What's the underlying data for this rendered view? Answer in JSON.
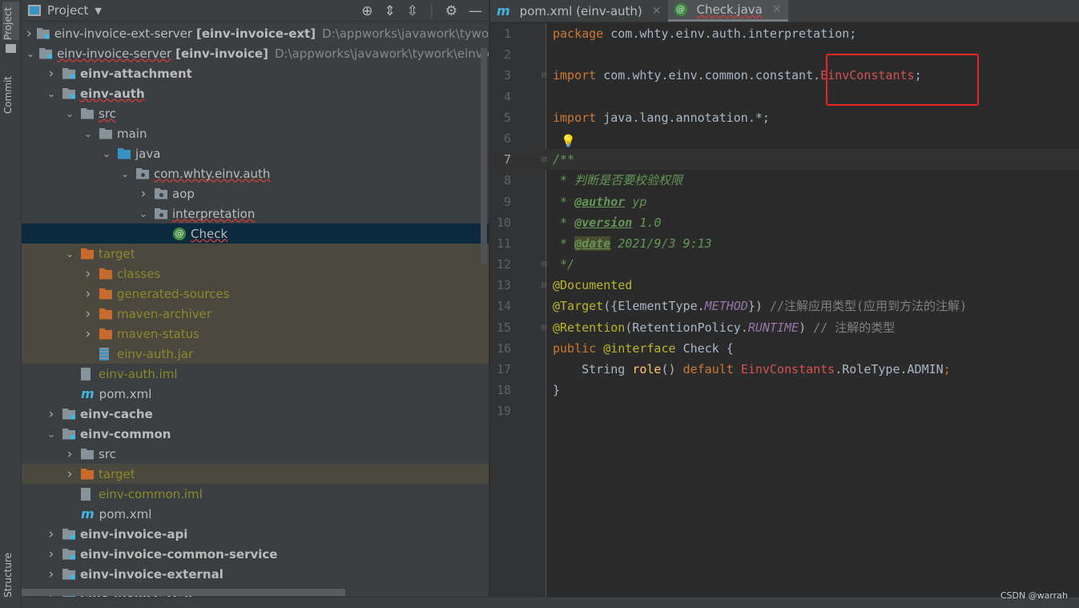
{
  "left_strip": {
    "project_tab": "Project",
    "commit_tab": "Commit",
    "structure_tab": "Structure"
  },
  "panel": {
    "title": "Project"
  },
  "tree": [
    {
      "label": "einv-invoice-ext-server",
      "suffix": "[einv-invoice-ext]",
      "path": "D:\\appworks\\javawork\\tywork\\einv\\einv-invoice-ext",
      "level": 0,
      "chev": "collapsed",
      "icon": "module-folder"
    },
    {
      "label": "einv-invoice-server",
      "suffix": "[einv-invoice]",
      "path": "D:\\appworks\\javawork\\tywork\\einv\\einv-invoice",
      "level": 0,
      "chev": "expanded",
      "icon": "module-folder",
      "squig": true
    },
    {
      "label": "einv-attachment",
      "level": 1,
      "chev": "collapsed",
      "icon": "module-folder",
      "bold": true
    },
    {
      "label": "einv-auth",
      "level": 1,
      "chev": "expanded",
      "icon": "module-folder",
      "bold": true,
      "squig": true
    },
    {
      "label": "src",
      "level": 2,
      "chev": "expanded",
      "icon": "folder",
      "squig": true
    },
    {
      "label": "main",
      "level": 3,
      "chev": "expanded",
      "icon": "folder"
    },
    {
      "label": "java",
      "level": 4,
      "chev": "expanded",
      "icon": "source-folder"
    },
    {
      "label": "com.whty.einv.auth",
      "level": 5,
      "chev": "expanded",
      "icon": "package",
      "squig": true
    },
    {
      "label": "aop",
      "level": 6,
      "chev": "collapsed",
      "icon": "package"
    },
    {
      "label": "interpretation",
      "level": 6,
      "chev": "expanded",
      "icon": "package",
      "squig": true
    },
    {
      "label": "Check",
      "level": 7,
      "icon": "annotation",
      "selected": true,
      "squig": true
    },
    {
      "label": "target",
      "level": 2,
      "chev": "expanded",
      "icon": "excluded-folder",
      "excluded": true
    },
    {
      "label": "classes",
      "level": 3,
      "chev": "collapsed",
      "icon": "excluded-folder",
      "excluded": true
    },
    {
      "label": "generated-sources",
      "level": 3,
      "chev": "collapsed",
      "icon": "excluded-folder",
      "excluded": true
    },
    {
      "label": "maven-archiver",
      "level": 3,
      "chev": "collapsed",
      "icon": "excluded-folder",
      "excluded": true
    },
    {
      "label": "maven-status",
      "level": 3,
      "chev": "collapsed",
      "icon": "excluded-folder",
      "excluded": true
    },
    {
      "label": "einv-auth.jar",
      "level": 3,
      "icon": "jar",
      "excluded": true
    },
    {
      "label": "einv-auth.iml",
      "level": 2,
      "icon": "iml",
      "olive": true
    },
    {
      "label": "pom.xml",
      "level": 2,
      "icon": "maven"
    },
    {
      "label": "einv-cache",
      "level": 1,
      "chev": "collapsed",
      "icon": "module-folder",
      "bold": true
    },
    {
      "label": "einv-common",
      "level": 1,
      "chev": "expanded",
      "icon": "module-folder",
      "bold": true
    },
    {
      "label": "src",
      "level": 2,
      "chev": "collapsed",
      "icon": "folder"
    },
    {
      "label": "target",
      "level": 2,
      "chev": "collapsed",
      "icon": "excluded-folder",
      "excluded": true
    },
    {
      "label": "einv-common.iml",
      "level": 2,
      "icon": "iml",
      "olive": true
    },
    {
      "label": "pom.xml",
      "level": 2,
      "icon": "maven"
    },
    {
      "label": "einv-invoice-api",
      "level": 1,
      "chev": "collapsed",
      "icon": "module-folder",
      "bold": true
    },
    {
      "label": "einv-invoice-common-service",
      "level": 1,
      "chev": "collapsed",
      "icon": "module-folder",
      "bold": true
    },
    {
      "label": "einv-invoice-external",
      "level": 1,
      "chev": "collapsed",
      "icon": "module-folder",
      "bold": true
    },
    {
      "label": "einv-invoice-rest",
      "level": 1,
      "chev": "collapsed",
      "icon": "module-folder",
      "bold": true
    }
  ],
  "tabs": [
    {
      "label": "pom.xml (einv-auth)",
      "icon": "maven-icon",
      "active": false
    },
    {
      "label": "Check.java",
      "icon": "annotation-icon",
      "active": true
    }
  ],
  "code": [
    [
      [
        "kw",
        "package "
      ],
      [
        "",
        "com.whty.einv.auth.interpretation;"
      ]
    ],
    [],
    [
      [
        "kw",
        "import "
      ],
      [
        "",
        "com.whty.einv.common.constant."
      ],
      [
        "red",
        "EinvConstants"
      ],
      [
        "",
        ";"
      ]
    ],
    [],
    [
      [
        "kw",
        "import "
      ],
      [
        "",
        "java.lang.annotation.*;"
      ]
    ],
    [],
    [
      [
        "cm",
        "/**"
      ]
    ],
    [
      [
        "cm",
        " * 判断是否要校验权限"
      ]
    ],
    [
      [
        "cm",
        " * "
      ],
      [
        "tag",
        "@author"
      ],
      [
        "cm",
        " yp"
      ]
    ],
    [
      [
        "cm",
        " * "
      ],
      [
        "tag",
        "@version"
      ],
      [
        "cm",
        " 1.0"
      ]
    ],
    [
      [
        "cm",
        " * "
      ],
      [
        "tag",
        "@date"
      ],
      [
        "cm",
        " 2021/9/3 9:13"
      ]
    ],
    [
      [
        "cm",
        " */"
      ]
    ],
    [
      [
        "ann",
        "@Documented"
      ]
    ],
    [
      [
        "ann",
        "@Target"
      ],
      [
        "",
        "({ElementType."
      ],
      [
        "st",
        "METHOD"
      ],
      [
        "",
        "}) "
      ],
      [
        "lc",
        "//注解应用类型(应用到方法的注解)"
      ]
    ],
    [
      [
        "ann",
        "@Retention"
      ],
      [
        "",
        "(RetentionPolicy."
      ],
      [
        "st",
        "RUNTIME"
      ],
      [
        "",
        ") "
      ],
      [
        "lc",
        "// 注解的类型"
      ]
    ],
    [
      [
        "kw",
        "public "
      ],
      [
        "ann",
        "@interface "
      ],
      [
        "",
        "Check {"
      ]
    ],
    [
      [
        "",
        "    String "
      ],
      [
        "fn",
        "role"
      ],
      [
        "",
        "() "
      ],
      [
        "kw",
        "default "
      ],
      [
        "red",
        "EinvConstants"
      ],
      [
        "",
        ".RoleType.ADMIN"
      ],
      [
        "kw",
        ";"
      ]
    ],
    [
      [
        "",
        "}"
      ]
    ],
    []
  ],
  "current_line": 7,
  "watermark": "CSDN @warrah",
  "colors": {
    "highlight_box": "#e8262a",
    "selection": "#0d293e",
    "excluded_bg": "#4b483f"
  }
}
